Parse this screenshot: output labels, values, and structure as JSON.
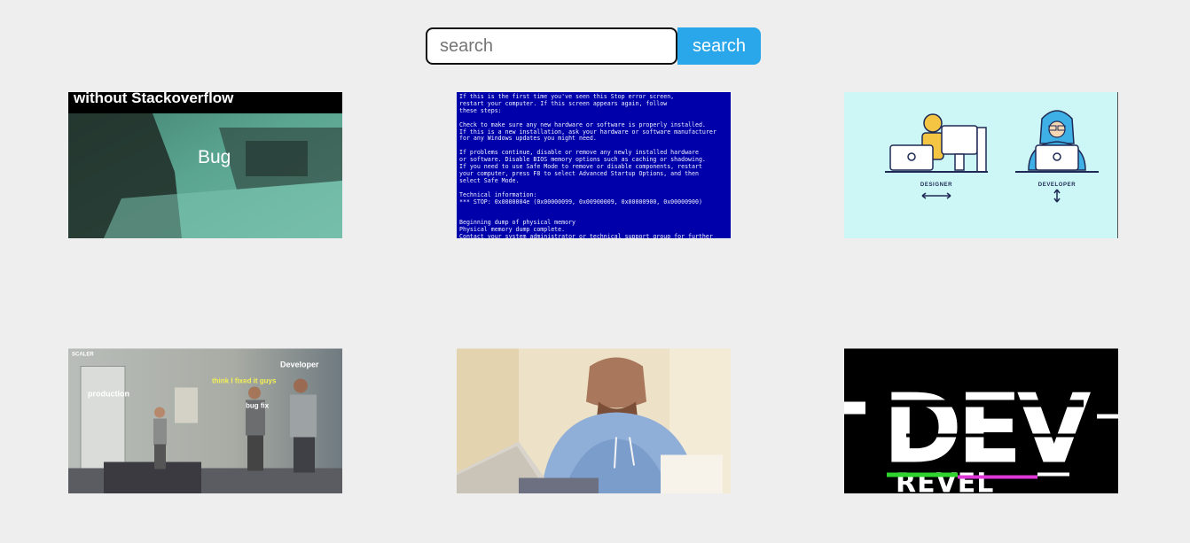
{
  "search": {
    "placeholder": "search",
    "value": "",
    "button_label": "search"
  },
  "gifs": [
    {
      "caption": "without Stackoverflow",
      "label": "Bug"
    },
    {
      "bsod_lines": [
        "If this is the first time you've seen this Stop error screen,",
        "restart your computer. If this screen appears again, follow",
        "these steps:",
        "",
        "Check to make sure any new hardware or software is properly installed.",
        "If this is a new installation, ask your hardware or software manufacturer",
        "for any Windows updates you might need.",
        "",
        "If problems continue, disable or remove any newly installed hardware",
        "or software. Disable BIOS memory options such as caching or shadowing.",
        "If you need to use Safe Mode to remove or disable components, restart",
        "your computer, press F8 to select Advanced Startup Options, and then",
        "select Safe Mode.",
        "",
        "Technical information:",
        "*** STOP: 0x0000004e (0x00000099, 0x00900009, 0x00000900, 0x00000900)",
        "",
        "",
        "Beginning dump of physical memory",
        "Physical memory dump complete.",
        "Contact your system administrator or technical support group for further"
      ]
    },
    {
      "left_label": "DESIGNER",
      "right_label": "DEVELOPER"
    },
    {
      "brand": "SCALER",
      "developer_label": "Developer",
      "fixed_label": "think I fixed it guys",
      "production_label": "production",
      "bugfix_label": "bug fix"
    },
    {},
    {
      "word1": "DEV",
      "word2": "REVEL"
    }
  ]
}
